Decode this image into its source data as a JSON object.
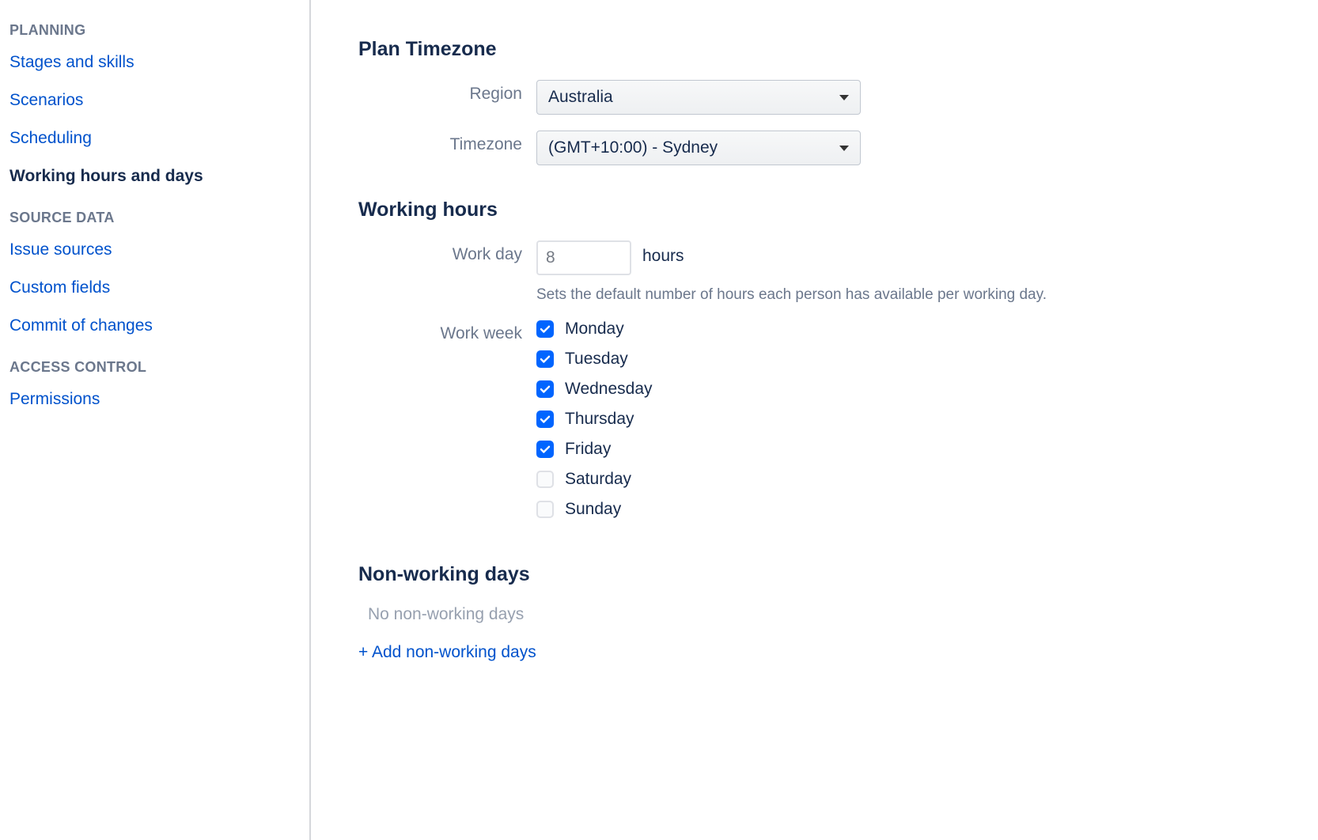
{
  "sidebar": {
    "sections": [
      {
        "heading": "PLANNING",
        "items": [
          {
            "label": "Stages and skills",
            "active": false
          },
          {
            "label": "Scenarios",
            "active": false
          },
          {
            "label": "Scheduling",
            "active": false
          },
          {
            "label": "Working hours and days",
            "active": true
          }
        ]
      },
      {
        "heading": "SOURCE DATA",
        "items": [
          {
            "label": "Issue sources",
            "active": false
          },
          {
            "label": "Custom fields",
            "active": false
          },
          {
            "label": "Commit of changes",
            "active": false
          }
        ]
      },
      {
        "heading": "ACCESS CONTROL",
        "items": [
          {
            "label": "Permissions",
            "active": false
          }
        ]
      }
    ]
  },
  "main": {
    "timezone": {
      "heading": "Plan Timezone",
      "region_label": "Region",
      "region_value": "Australia",
      "timezone_label": "Timezone",
      "timezone_value": "(GMT+10:00) - Sydney"
    },
    "working_hours": {
      "heading": "Working hours",
      "workday_label": "Work day",
      "workday_value": "8",
      "workday_suffix": "hours",
      "workday_help": "Sets the default number of hours each person has available per working day.",
      "workweek_label": "Work week",
      "days": [
        {
          "label": "Monday",
          "checked": true
        },
        {
          "label": "Tuesday",
          "checked": true
        },
        {
          "label": "Wednesday",
          "checked": true
        },
        {
          "label": "Thursday",
          "checked": true
        },
        {
          "label": "Friday",
          "checked": true
        },
        {
          "label": "Saturday",
          "checked": false
        },
        {
          "label": "Sunday",
          "checked": false
        }
      ]
    },
    "non_working": {
      "heading": "Non-working days",
      "empty": "No non-working days",
      "add_link": "+ Add non-working days"
    }
  }
}
